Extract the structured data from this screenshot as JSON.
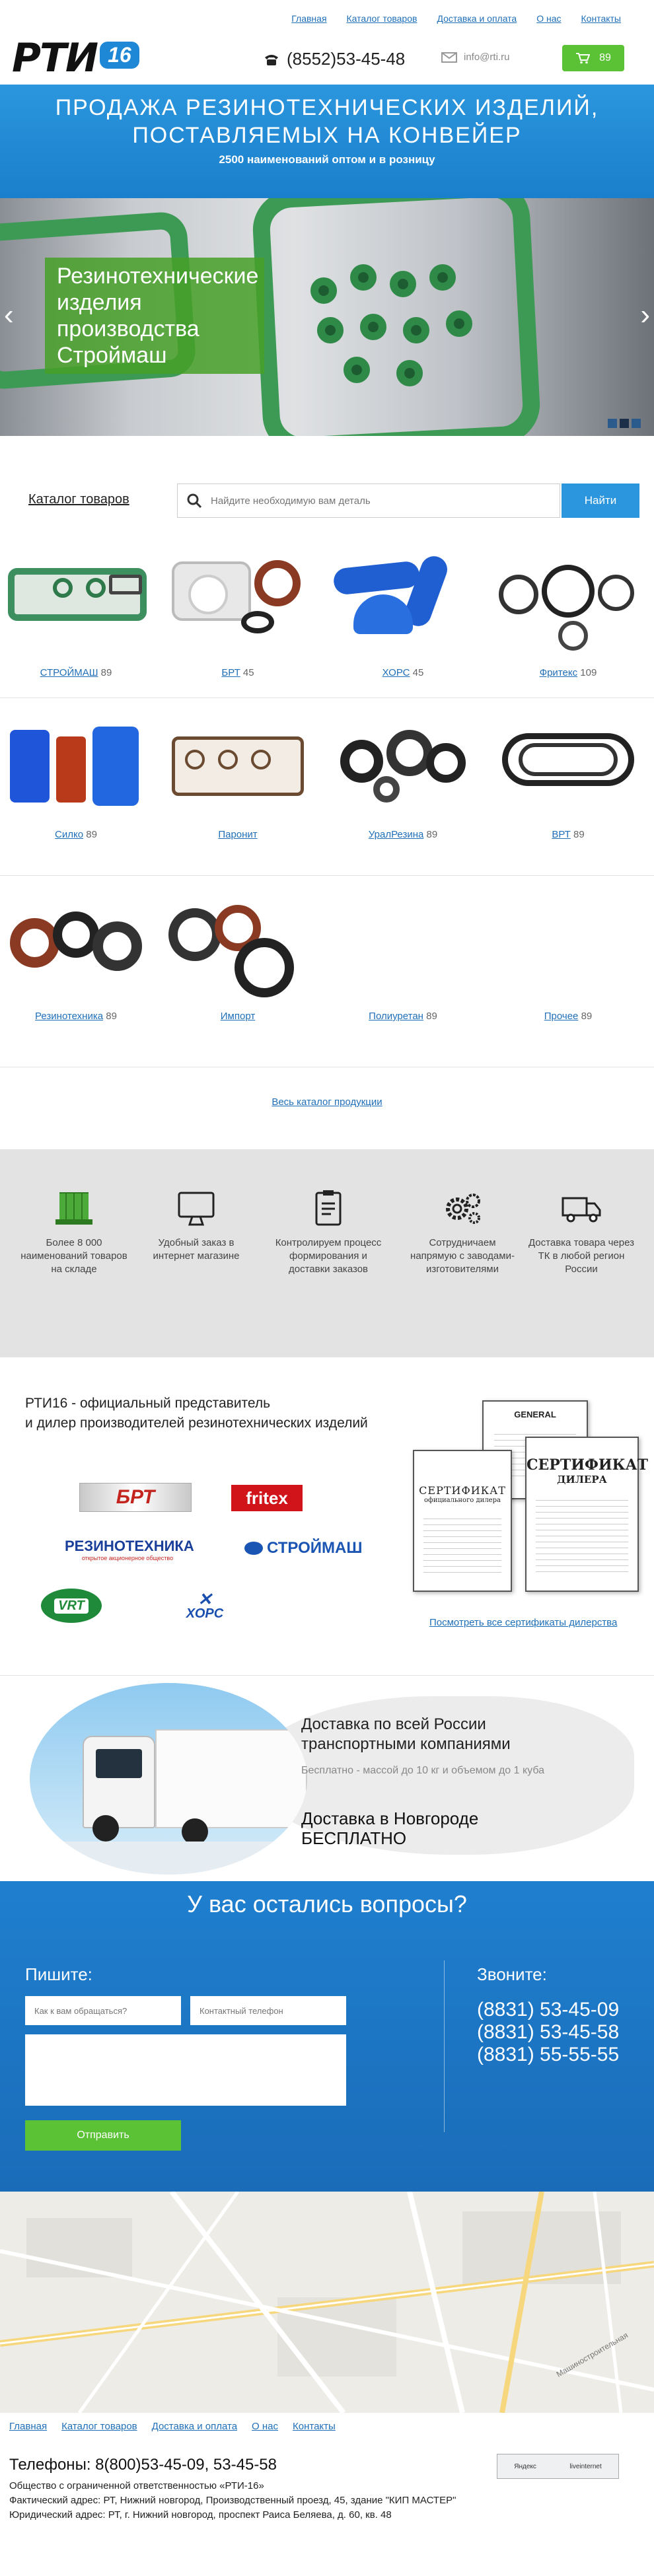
{
  "nav": [
    "Главная",
    "Каталог товаров",
    "Доставка и оплата",
    "О нас",
    "Контакты"
  ],
  "header": {
    "logo_text": "РТИ",
    "logo_badge": "16",
    "phone": "(8552)53-45-48",
    "email": "info@rti.ru",
    "cart_count": "89"
  },
  "banner": {
    "title": "Продажа резинотехнических изделий, поставляемых на конвейер",
    "subtitle": "2500 наименований оптом и в розницу"
  },
  "slider": {
    "caption": "Резинотехнические изделия производства Строймаш",
    "prev": "‹",
    "next": "›"
  },
  "catalog": {
    "title": "Каталог товаров",
    "search_placeholder": "Найдите необходимую вам деталь",
    "search_button": "Найти",
    "all_link": "Весь каталог продукции",
    "items": [
      {
        "name": "СТРОЙМАШ",
        "count": "89"
      },
      {
        "name": "БРТ",
        "count": "45"
      },
      {
        "name": "ХОРС",
        "count": "45"
      },
      {
        "name": "Фритекс",
        "count": "109"
      },
      {
        "name": "Силко",
        "count": "89"
      },
      {
        "name": "Паронит",
        "count": ""
      },
      {
        "name": "УралРезина",
        "count": "89"
      },
      {
        "name": "ВРТ",
        "count": "89"
      },
      {
        "name": "Резинотехника",
        "count": "89"
      },
      {
        "name": "Импорт",
        "count": ""
      },
      {
        "name": "Полиуретан",
        "count": "89"
      },
      {
        "name": "Прочее",
        "count": "89"
      }
    ]
  },
  "features": [
    {
      "icon": "warehouse-icon",
      "text": "Более 8 000 наименований товаров на складе"
    },
    {
      "icon": "monitor-icon",
      "text": "Удобный заказ в интернет магазине"
    },
    {
      "icon": "clipboard-icon",
      "text": "Контролируем процесс формирования и доставки заказов"
    },
    {
      "icon": "gears-icon",
      "text": "Сотрудничаем напрямую с заводами-изготовителями"
    },
    {
      "icon": "truck-icon",
      "text": "Доставка товара через ТК в любой регион России"
    }
  ],
  "dealer": {
    "title_line1": "РТИ16 - официальный представитель",
    "title_line2": "и дилер производителей резинотехнических изделий",
    "brands": [
      "БРТ",
      "fritex",
      "РЕЗИНОТЕХНИКА",
      "открытое акционерное общество",
      "СТРОЙМАШ",
      "VRT",
      "ХОРС"
    ],
    "certs_link": "Посмотреть все сертификаты дилерства",
    "cert_texts": [
      "СЕРТИФИКАТ",
      "официального дилера",
      "СЕРТИФИКАТ",
      "ДИЛЕРА",
      "GENERAL",
      "СЕРТИФИКАТ"
    ]
  },
  "delivery": {
    "line1": "Доставка по всей России",
    "line2": "транспортными компаниями",
    "note": "Бесплатно - массой до 10 кг и объемом до 1 куба",
    "free1": "Доставка в Новгороде",
    "free2": "БЕСПЛАТНО"
  },
  "contact": {
    "title": "У вас остались вопросы?",
    "write_label": "Пишите:",
    "call_label": "Звоните:",
    "name_placeholder": "Как к вам обращаться?",
    "phone_placeholder": "Контактный телефон",
    "send_button": "Отправить",
    "phones": [
      "(8831) 53-45-09",
      "(8831) 53-45-58",
      "(8831) 55-55-55"
    ]
  },
  "map": {
    "street_label": "Машиностроительная"
  },
  "footer": {
    "phones": "Телефоны: 8(800)53-45-09, 53-45-58",
    "org": "Общество с ограниченной ответственностью «РТИ-16»",
    "actual": "Фактический адрес: РТ, Нижний новгород, Производственный проезд, 45, здание \"КИП МАСТЕР\"",
    "legal": "Юридический адрес: РТ, г. Нижний новгород, проспект Раиса Беляева, д. 60, кв. 48",
    "counter1": "Яндекс",
    "counter2": "liveinternet"
  },
  "colors": {
    "accent": "#2b96dd",
    "green": "#5bc236",
    "link": "#1f6fb8"
  }
}
